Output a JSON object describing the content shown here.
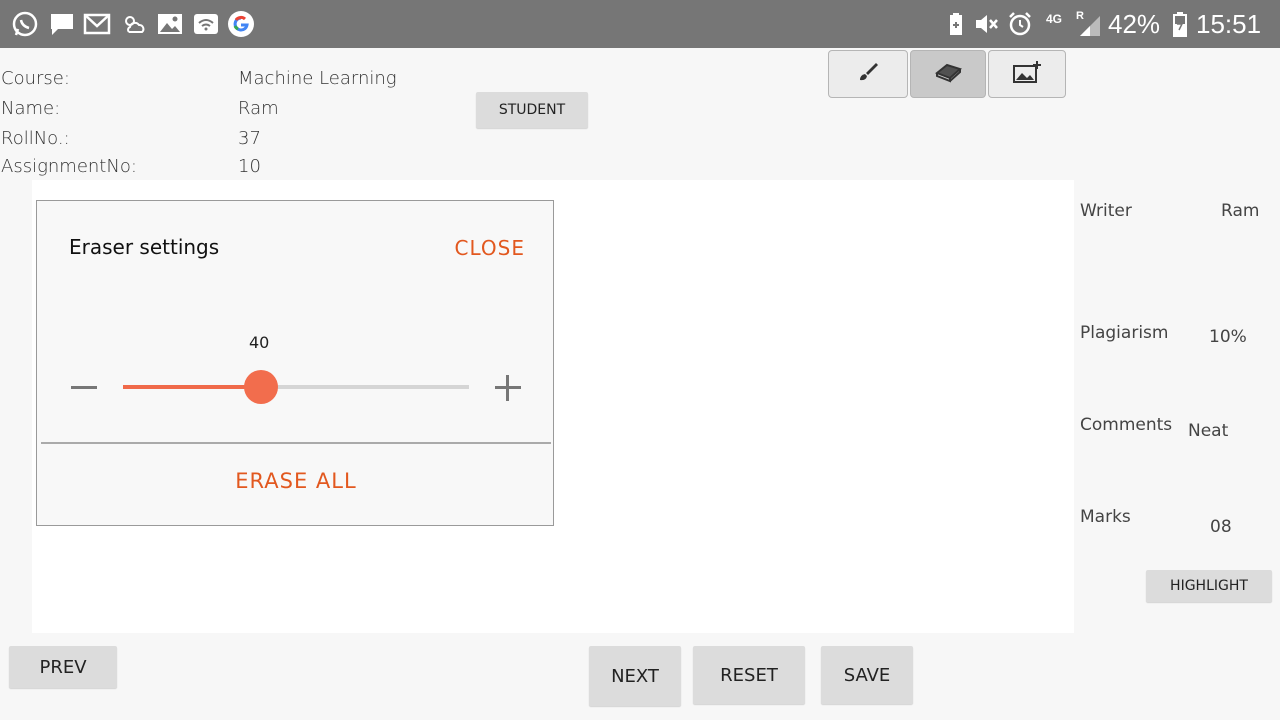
{
  "status_bar": {
    "battery": "42%",
    "time": "15:51",
    "network": "4G",
    "roaming": "R",
    "icons": [
      "whatsapp-icon",
      "message-icon",
      "gmail-icon",
      "weather-icon",
      "gallery-icon",
      "wifi-icon",
      "google-icon",
      "battery-saver-icon",
      "mute-icon",
      "alarm-icon",
      "signal-icon",
      "battery-icon"
    ]
  },
  "info": {
    "course_label": "Course:",
    "course_value": "Machine Learning",
    "name_label": "Name:",
    "name_value": "Ram",
    "roll_label": "RollNo.:",
    "roll_value": "37",
    "assignment_label": "AssignmentNo:",
    "assignment_value": "10"
  },
  "student_button": "STUDENT",
  "toolbar": {
    "tools": [
      "brush-icon",
      "eraser-icon",
      "add-image-icon"
    ],
    "active": "eraser-icon"
  },
  "dialog": {
    "title": "Eraser settings",
    "close_label": "CLOSE",
    "slider_value": "40",
    "slider_fraction": 0.4,
    "erase_all_label": "ERASE ALL"
  },
  "side_panel": {
    "writer_label": "Writer",
    "writer_value": "Ram",
    "plagiarism_label": "Plagiarism",
    "plagiarism_value": "10%",
    "comments_label": "Comments",
    "comments_value": "Neat",
    "marks_label": "Marks",
    "marks_value": "08",
    "highlight_label": "HIGHLIGHT"
  },
  "nav": {
    "prev": "PREV",
    "next": "NEXT",
    "reset": "RESET",
    "save": "SAVE"
  },
  "colors": {
    "accent": "#e2581f",
    "slider": "#f26d4d",
    "status_bar": "#767676"
  }
}
